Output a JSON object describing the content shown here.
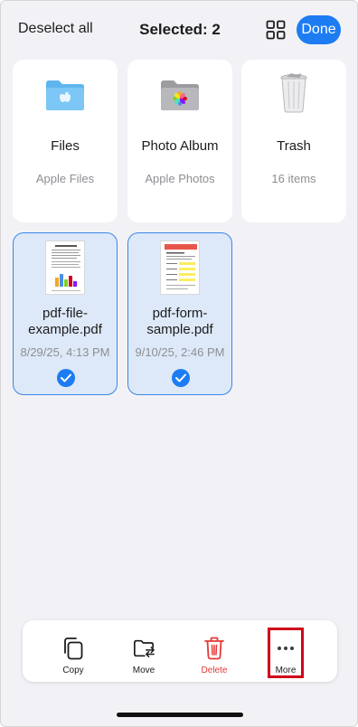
{
  "header": {
    "deselect_label": "Deselect all",
    "title": "Selected: 2",
    "done_label": "Done",
    "grid_icon": "grid-view-icon"
  },
  "locations": [
    {
      "name": "Files",
      "sub": "Apple Files",
      "icon": "files-folder-icon",
      "selected": false
    },
    {
      "name": "Photo Album",
      "sub": "Apple Photos",
      "icon": "photos-folder-icon",
      "selected": false
    },
    {
      "name": "Trash",
      "sub": "16 items",
      "icon": "trash-bin-icon",
      "selected": false
    }
  ],
  "files": [
    {
      "name": "pdf-file-example.pdf",
      "name_line1": "pdf-file-",
      "name_line2": "example.pdf",
      "date": "8/29/25, 4:13 PM",
      "selected": true
    },
    {
      "name": "pdf-form-sample.pdf",
      "name_line1": "pdf-form-",
      "name_line2": "sample.pdf",
      "date": "9/10/25, 2:46 PM",
      "selected": true
    }
  ],
  "toolbar": {
    "copy_label": "Copy",
    "move_label": "Move",
    "delete_label": "Delete",
    "more_label": "More"
  },
  "colors": {
    "accent": "#1d7cf2",
    "delete": "#e53935",
    "highlight": "#d0021b",
    "selected_bg": "#dde9f8"
  }
}
